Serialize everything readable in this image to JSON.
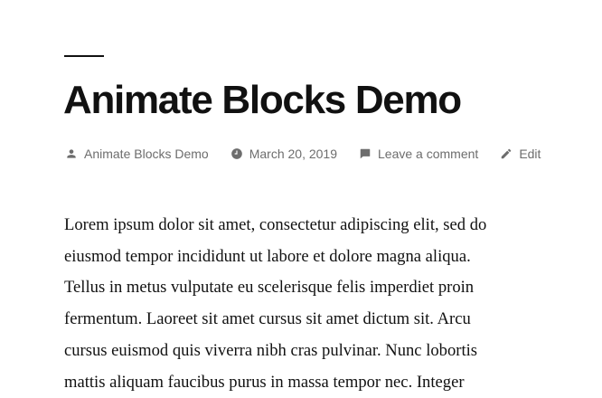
{
  "post": {
    "title": "Animate Blocks Demo",
    "meta": {
      "author": "Animate Blocks Demo",
      "date": "March 20, 2019",
      "comments": "Leave a comment",
      "edit": "Edit"
    },
    "content_lines": [
      "Lorem ipsum dolor sit amet, consectetur adipiscing elit, sed do",
      "eiusmod tempor incididunt ut labore et dolore magna aliqua.",
      "Tellus in metus vulputate eu scelerisque felis imperdiet proin",
      "fermentum. Laoreet sit amet cursus sit amet dictum sit. Arcu",
      "cursus euismod quis viverra nibh cras pulvinar. Nunc lobortis",
      "mattis aliquam faucibus purus in massa tempor nec. Integer"
    ]
  },
  "icons": {
    "author": "person-icon",
    "date": "clock-icon",
    "comments": "comment-icon",
    "edit": "pencil-icon"
  },
  "colors": {
    "text": "#111111",
    "meta": "#6d6d6d",
    "background": "#ffffff"
  }
}
